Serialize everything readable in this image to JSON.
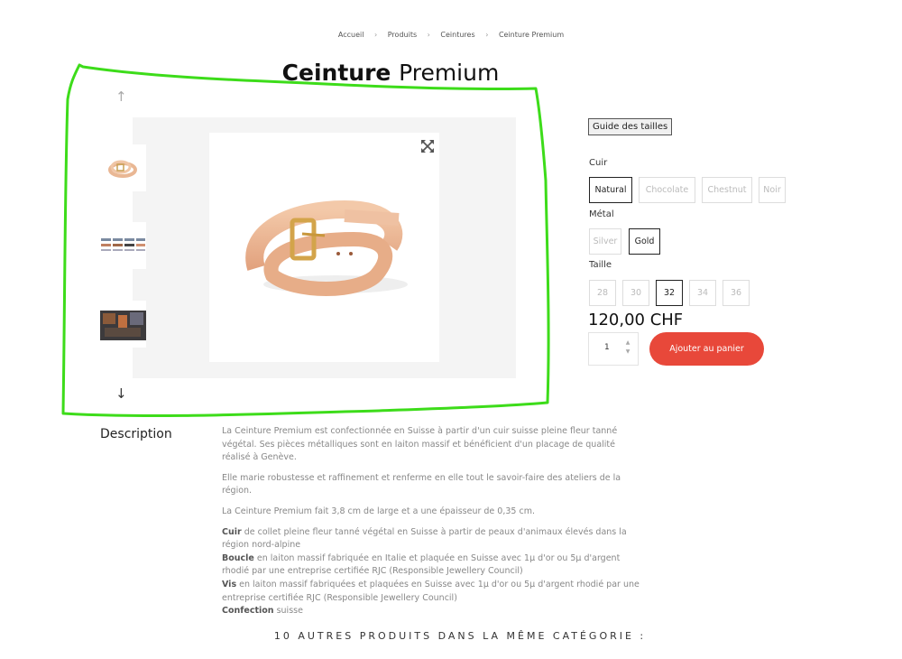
{
  "breadcrumb": [
    "Accueil",
    "Produits",
    "Ceintures",
    "Ceinture Premium"
  ],
  "breadcrumb_separator": "›",
  "product": {
    "title_bold": "Ceinture",
    "title_regular": "Premium",
    "main_image": "belt-natural-gold-buckle"
  },
  "gallery": {
    "arrow_up": "↑",
    "arrow_down": "↓",
    "thumbnails": [
      "belt-coiled-thumbnail",
      "belt-lineup-thumbnail",
      "workshop-thumbnail"
    ],
    "expand_icon": "expand-arrows-icon"
  },
  "options": {
    "size_guide_label": "Guide des tailles",
    "leather": {
      "label": "Cuir",
      "values": [
        "Natural",
        "Chocolate",
        "Chestnut",
        "Noir"
      ],
      "selected": "Natural"
    },
    "metal": {
      "label": "Métal",
      "values": [
        "Silver",
        "Gold"
      ],
      "selected": "Gold"
    },
    "size": {
      "label": "Taille",
      "values": [
        "28",
        "30",
        "32",
        "34",
        "36"
      ],
      "selected": "32"
    }
  },
  "price": "120,00 CHF",
  "quantity": "1",
  "add_to_cart_label": "Ajouter au panier",
  "description": {
    "title": "Description",
    "paragraphs": [
      "La Ceinture Premium est confectionnée en Suisse à partir d'un cuir suisse pleine fleur tanné végétal. Ses pièces métalliques sont en laiton massif et bénéficient d'un placage de qualité réalisé à Genève.",
      "Elle marie robustesse et raffinement et renferme en elle tout le savoir-faire des ateliers de la région.",
      "La Ceinture Premium fait 3,8 cm de large et a une épaisseur de 0,35 cm."
    ],
    "specs": [
      {
        "term": "Cuir",
        "text": " de collet pleine fleur tanné végétal en Suisse à partir de peaux d'animaux élevés dans la région nord-alpine"
      },
      {
        "term": "Boucle",
        "text": " en laiton massif fabriquée en Italie et plaquée en Suisse avec 1µ d'or ou 5µ d'argent rhodié par une entreprise certifiée RJC (Responsible Jewellery Council)"
      },
      {
        "term": "Vis",
        "text": " en laiton massif fabriquées et plaquées en Suisse avec 1µ d'or ou 5µ d'argent rhodié par une entreprise certifiée RJC (Responsible Jewellery Council)"
      },
      {
        "term": "Confection",
        "text": " suisse"
      }
    ]
  },
  "related_heading": "10 AUTRES PRODUITS DANS LA MÊME CATÉGORIE :",
  "colors": {
    "accent": "#e8483a",
    "annotation": "#3ddc1a"
  }
}
